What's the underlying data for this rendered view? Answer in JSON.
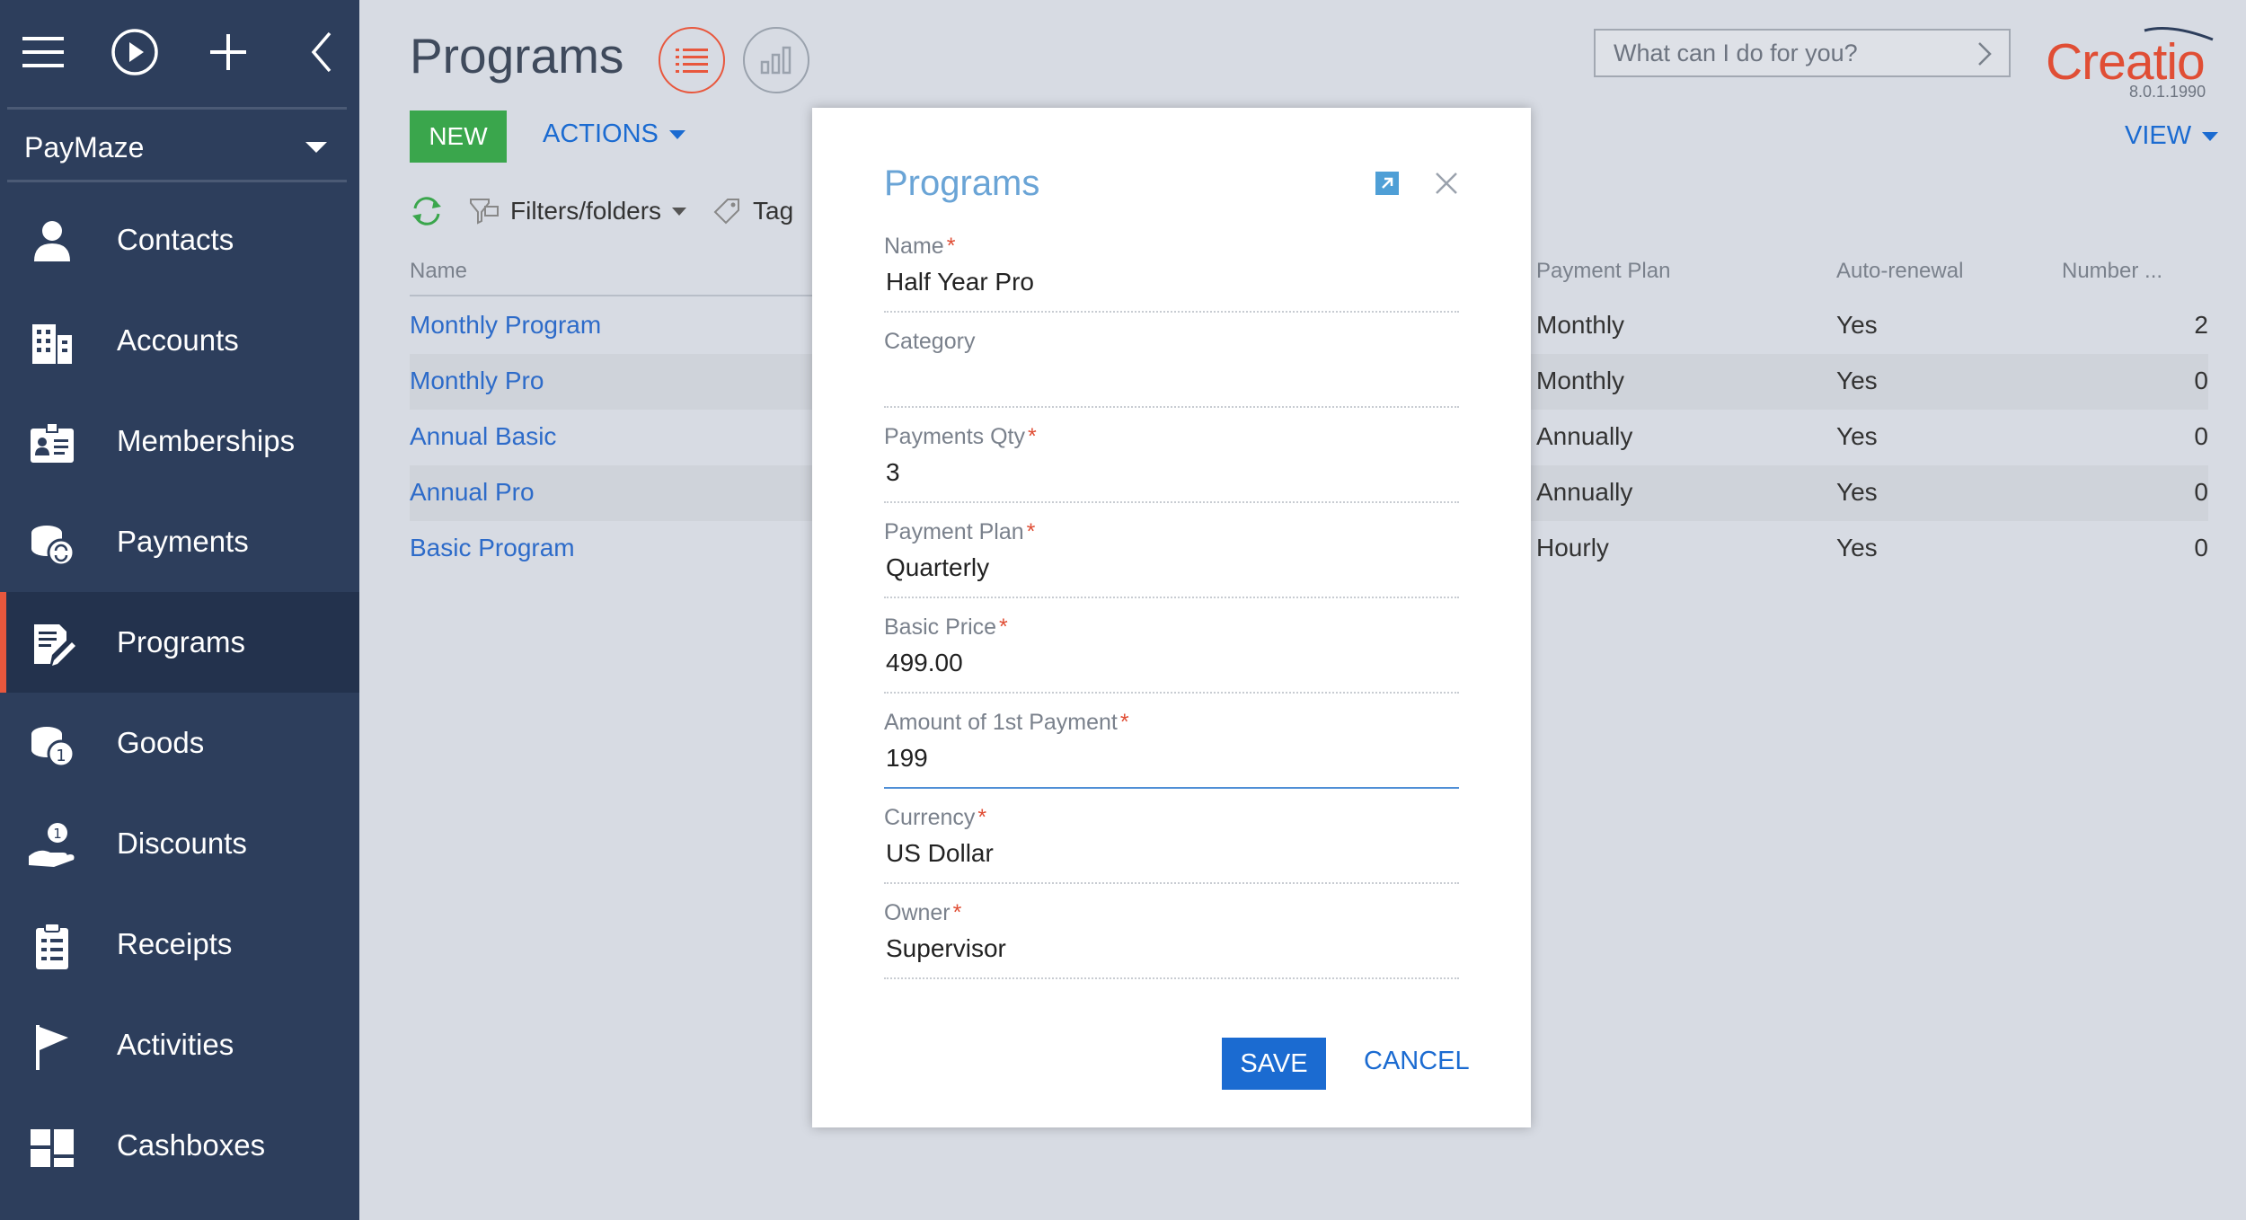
{
  "sidebar": {
    "workspace": "PayMaze",
    "items": [
      {
        "label": "Contacts",
        "icon": "contact-icon"
      },
      {
        "label": "Accounts",
        "icon": "building-icon"
      },
      {
        "label": "Memberships",
        "icon": "id-card-icon"
      },
      {
        "label": "Payments",
        "icon": "coins-icon"
      },
      {
        "label": "Programs",
        "icon": "edit-document-icon",
        "active": true
      },
      {
        "label": "Goods",
        "icon": "coins-one-icon"
      },
      {
        "label": "Discounts",
        "icon": "hand-coin-icon"
      },
      {
        "label": "Receipts",
        "icon": "clipboard-icon"
      },
      {
        "label": "Activities",
        "icon": "flag-icon"
      },
      {
        "label": "Cashboxes",
        "icon": "dashboard-icon"
      }
    ]
  },
  "header": {
    "title": "Programs",
    "new_label": "NEW",
    "actions_label": "ACTIONS",
    "view_label": "VIEW",
    "search_placeholder": "What can I do for you?",
    "logo": "Creatio",
    "version": "8.0.1.1990"
  },
  "filters": {
    "filters_label": "Filters/folders",
    "tag_label": "Tag"
  },
  "grid": {
    "columns": {
      "name": "Name",
      "payment_plan": "Payment Plan",
      "auto_renewal": "Auto-renewal",
      "number": "Number ..."
    },
    "rows": [
      {
        "name": "Monthly Program",
        "payment_plan": "Monthly",
        "auto_renewal": "Yes",
        "number": "2"
      },
      {
        "name": "Monthly Pro",
        "payment_plan": "Monthly",
        "auto_renewal": "Yes",
        "number": "0"
      },
      {
        "name": "Annual Basic",
        "payment_plan": "Annually",
        "auto_renewal": "Yes",
        "number": "0"
      },
      {
        "name": "Annual Pro",
        "payment_plan": "Annually",
        "auto_renewal": "Yes",
        "number": "0"
      },
      {
        "name": "Basic Program",
        "payment_plan": "Hourly",
        "auto_renewal": "Yes",
        "number": "0"
      }
    ]
  },
  "modal": {
    "title": "Programs",
    "fields": [
      {
        "label": "Name",
        "required": "*",
        "value": "Half Year Pro"
      },
      {
        "label": "Category",
        "required": "",
        "value": ""
      },
      {
        "label": "Payments Qty",
        "required": "*",
        "value": "3"
      },
      {
        "label": "Payment Plan",
        "required": "*",
        "value": "Quarterly"
      },
      {
        "label": "Basic Price",
        "required": "*",
        "value": "499.00"
      },
      {
        "label": "Amount of 1st Payment",
        "required": "*",
        "value": "199"
      },
      {
        "label": "Currency",
        "required": "*",
        "value": "US Dollar"
      },
      {
        "label": "Owner",
        "required": "*",
        "value": "Supervisor"
      }
    ],
    "save_label": "SAVE",
    "cancel_label": "CANCEL"
  },
  "colors": {
    "sidebar_bg": "#2d3e5c",
    "accent_orange": "#e8573d",
    "new_button": "#3aa64c",
    "link_blue": "#1b6bd1",
    "modal_title": "#6aa4d6"
  }
}
